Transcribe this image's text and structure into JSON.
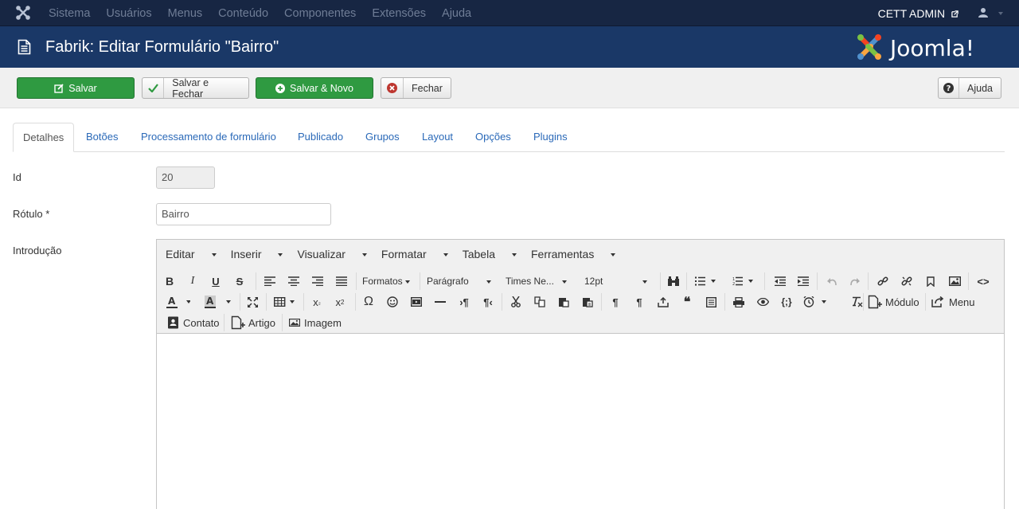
{
  "topbar": {
    "menu": [
      "Sistema",
      "Usuários",
      "Menus",
      "Conteúdo",
      "Componentes",
      "Extensões",
      "Ajuda"
    ],
    "user": "CETT ADMIN"
  },
  "header": {
    "title": "Fabrik: Editar Formulário \"Bairro\"",
    "brand": "Joomla!"
  },
  "toolbar": {
    "save": "Salvar",
    "save_close": "Salvar e Fechar",
    "save_new": "Salvar & Novo",
    "close": "Fechar",
    "help": "Ajuda"
  },
  "tabs": [
    "Detalhes",
    "Botões",
    "Processamento de formulário",
    "Publicado",
    "Grupos",
    "Layout",
    "Opções",
    "Plugins"
  ],
  "form": {
    "id_label": "Id",
    "id_value": "20",
    "label_label": "Rótulo *",
    "label_value": "Bairro",
    "intro_label": "Introdução"
  },
  "editor": {
    "menus": [
      "Editar",
      "Inserir",
      "Visualizar",
      "Formatar",
      "Tabela",
      "Ferramentas"
    ],
    "formats": "Formatos",
    "block": "Parágrafo",
    "font": "Times Ne...",
    "size": "12pt",
    "modulo": "Módulo",
    "menu": "Menu",
    "contato": "Contato",
    "artigo": "Artigo",
    "imagem": "Imagem"
  },
  "colors": {
    "topbar": "#172643",
    "header": "#1a3867",
    "green": "#2f9a41",
    "link": "#2a69b8"
  }
}
